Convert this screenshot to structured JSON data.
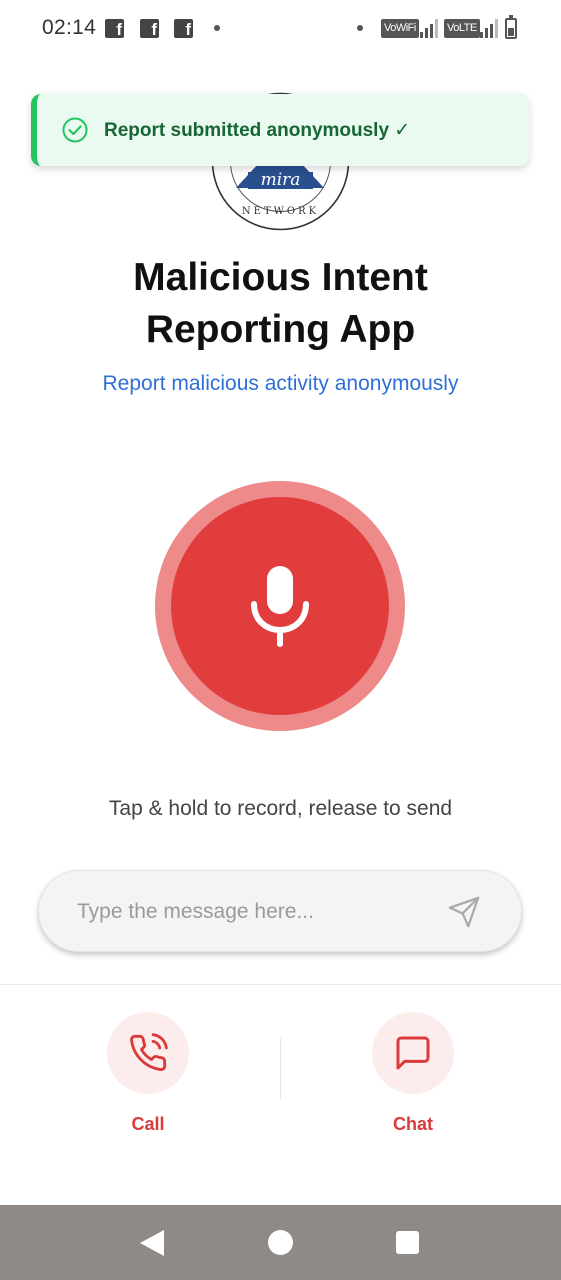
{
  "status_bar": {
    "time": "02:14",
    "notification_icons": [
      "facebook-icon",
      "facebook-icon",
      "facebook-icon"
    ],
    "network_badges": [
      "VoWiFi",
      "VoLTE"
    ]
  },
  "toast": {
    "message": "Report submitted anonymously ✓",
    "icon": "check-circle-icon",
    "accent_color": "#22c55e"
  },
  "logo": {
    "brand_text": "mira",
    "sub_text": "NETWORK"
  },
  "header": {
    "title_line1": "Malicious Intent",
    "title_line2": "Reporting App",
    "subtitle": "Report malicious activity anonymously"
  },
  "record": {
    "icon": "microphone-icon",
    "hint": "Tap & hold to record, release to send",
    "color": "#e23d3d"
  },
  "message": {
    "placeholder": "Type the message here...",
    "value": "",
    "send_icon": "send-icon"
  },
  "actions": {
    "call_label": "Call",
    "call_icon": "phone-icon",
    "chat_label": "Chat",
    "chat_icon": "chat-bubble-icon"
  },
  "nav": {
    "back_icon": "back-icon",
    "home_icon": "home-icon",
    "recents_icon": "recents-icon"
  }
}
